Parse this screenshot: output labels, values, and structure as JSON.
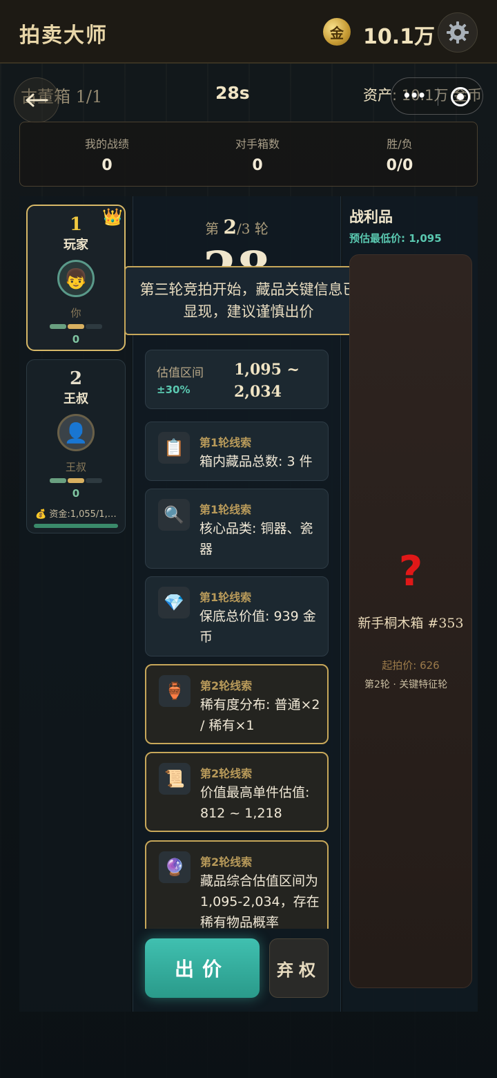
{
  "header": {
    "app_title": "拍卖大师",
    "coin_glyph": "金",
    "coin_amount": "10.1万",
    "settings_icon": "gear-icon"
  },
  "subbar": {
    "box_label": "古董箱 1/1",
    "timer": "28s",
    "assets": "资产: 10.1万 金币",
    "back_icon": "arrow-left-icon",
    "capsule_dots": "•••"
  },
  "stats": [
    {
      "label": "我的战绩",
      "value": "0"
    },
    {
      "label": "对手箱数",
      "value": "0"
    },
    {
      "label": "胜/负",
      "value": "0/0"
    }
  ],
  "players": [
    {
      "rank": "1",
      "name": "玩家",
      "avatar": "👦",
      "sub": "你",
      "score": "0",
      "crown": "👑"
    },
    {
      "rank": "2",
      "name": "王叔",
      "avatar": "👤",
      "sub": "王叔",
      "score": "0",
      "funds": "💰 资金:1,055/1,…"
    }
  ],
  "round": {
    "prefix": "第",
    "current": "2",
    "total": "/3",
    "suffix": "轮",
    "big_timer": "28"
  },
  "toast": "第三轮竞拍开始，藏品关键信息已显现，建议谨慎出价",
  "estimate": {
    "label": "估值区间",
    "pct": "±30%",
    "range_low": "1,095 ~",
    "range_high": "2,034"
  },
  "clues": [
    {
      "icon": "📋",
      "title": "第1轮线索",
      "desc": "箱内藏品总数: 3 件"
    },
    {
      "icon": "🔍",
      "title": "第1轮线索",
      "desc": "核心品类: 铜器、瓷器"
    },
    {
      "icon": "💎",
      "title": "第1轮线索",
      "desc": "保底总价值: 939 金币"
    },
    {
      "icon": "🏺",
      "title": "第2轮线索",
      "desc": "稀有度分布: 普通×2 / 稀有×1"
    },
    {
      "icon": "📜",
      "title": "第2轮线索",
      "desc": "价值最高单件估值: 812 ~ 1,218"
    },
    {
      "icon": "🔮",
      "title": "第2轮线索",
      "desc": "藏品综合估值区间为 1,095-2,034，存在稀有物品概率"
    }
  ],
  "actions": {
    "bid": "出价",
    "fold": "弃权"
  },
  "loot": {
    "title": "战利品",
    "min_price": "预估最低价: 1,095",
    "qmark": "?",
    "box_name": "新手桐木箱 #353",
    "start_price": "起拍价: 626",
    "round_note": "第2轮 · 关键特征轮"
  },
  "colors": {
    "accent": "#40c0b0",
    "gold": "#c8a85a",
    "warning": "#e01818"
  }
}
